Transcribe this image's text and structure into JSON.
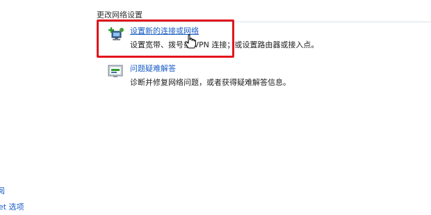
{
  "section": {
    "heading": "更改网络设置"
  },
  "tasks": [
    {
      "title": "设置新的连接或网络",
      "description": "设置宽带、拨号或 VPN 连接；或设置路由器或接入点。",
      "icon": "network-add-icon"
    },
    {
      "title": "问题疑难解答",
      "description": "诊断并修复网络问题，或者获得疑难解答信息。",
      "icon": "troubleshoot-icon"
    }
  ],
  "left_panel": {
    "link_1": "阅",
    "link_2": "et 选项"
  },
  "colors": {
    "link": "#1a5ec7",
    "highlight": "#e2141b",
    "divider": "#d9e2ec"
  }
}
